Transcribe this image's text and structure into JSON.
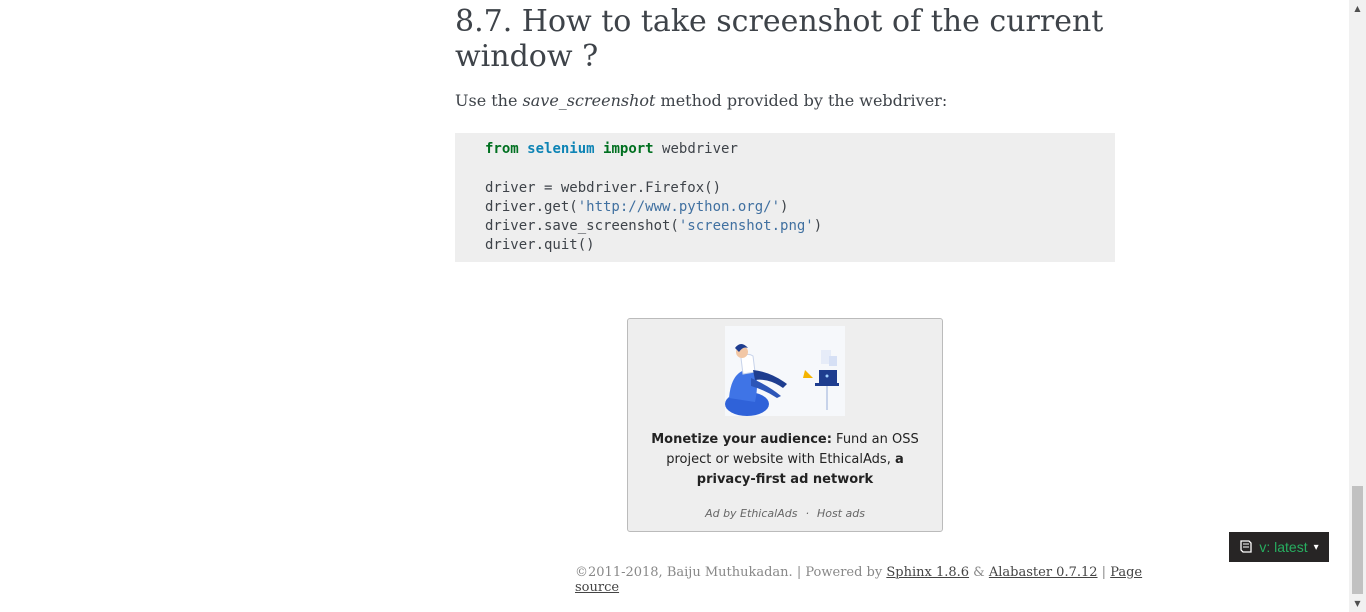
{
  "heading": {
    "line1": "8.7. How to take screenshot of the current",
    "line2": "window ?"
  },
  "intro": {
    "before": "Use the ",
    "method": "save_screenshot",
    "after": " method provided by the webdriver:"
  },
  "code": {
    "line1_from": "from",
    "line1_module": "selenium",
    "line1_import": "import",
    "line1_rest": " webdriver",
    "line3": "driver = webdriver.Firefox()",
    "line4_pre": "driver.get(",
    "line4_str": "'http://www.python.org/'",
    "line4_post": ")",
    "line5_pre": "driver.save_screenshot(",
    "line5_str": "'screenshot.png'",
    "line5_post": ")",
    "line6": "driver.quit()"
  },
  "ad": {
    "bold_lead": "Monetize your audience:",
    "text_mid": " Fund an OSS project or website with EthicalAds, ",
    "bold_tail": "a privacy-first ad network",
    "footer_by": "Ad by EthicalAds",
    "footer_sep": "·",
    "footer_host": "Host ads"
  },
  "version_badge": {
    "icon": "book-icon",
    "label": "v: latest",
    "caret": "▾"
  },
  "footer": {
    "copyright": "©2011-2018, Baiju Muthukadan. | Powered by ",
    "sphinx": "Sphinx 1.8.6",
    "amp": " & ",
    "alabaster": "Alabaster 0.7.12",
    "sep": " | ",
    "page_source": "Page source"
  },
  "colors": {
    "keyword": "#007020",
    "module": "#0e84b5",
    "string": "#4070a0",
    "badge_bg": "#272525",
    "badge_text": "#27ae60"
  }
}
